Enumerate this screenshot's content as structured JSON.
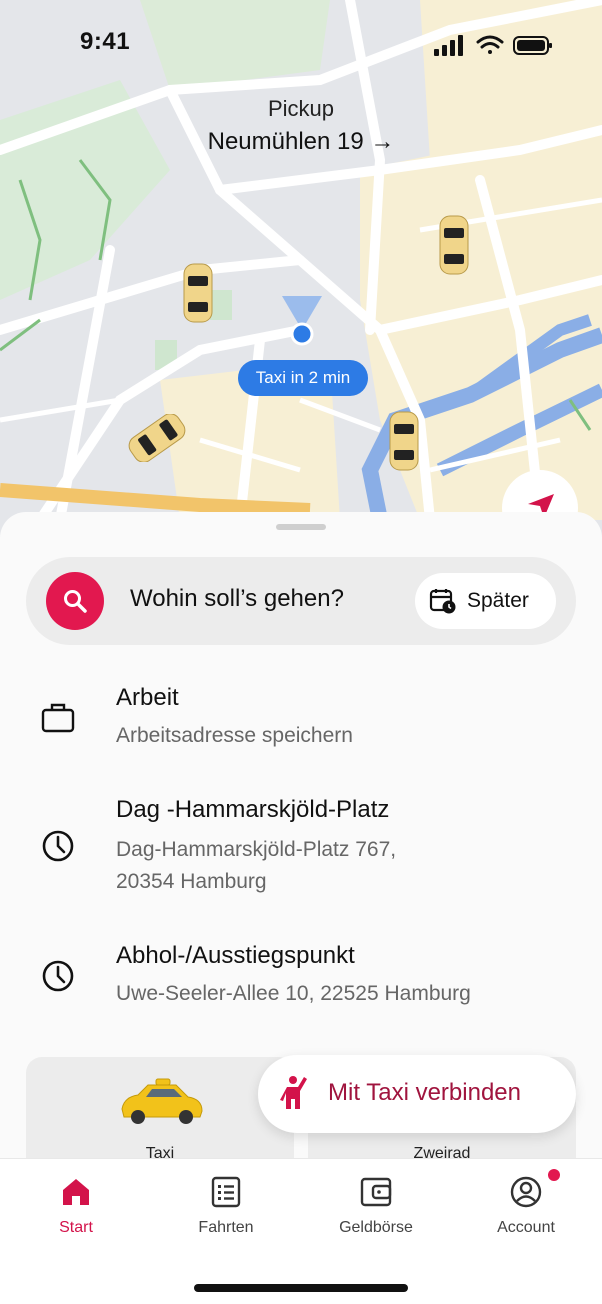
{
  "status": {
    "time": "9:41"
  },
  "map": {
    "pickup_label": "Pickup",
    "pickup_address": "Neumühlen 19 →",
    "taxi_eta": "Taxi in 2 min"
  },
  "search": {
    "placeholder": "Wohin soll’s gehen?",
    "later_label": "Später"
  },
  "places": [
    {
      "title": "Arbeit",
      "subtitle": "Arbeitsadresse speichern",
      "icon": "briefcase-icon"
    },
    {
      "title": "Dag -Hammarskjöld-Platz",
      "subtitle_line1": "Dag-Hammarskjöld-Platz 767,",
      "subtitle_line2": "20354 Hamburg",
      "icon": "clock-icon"
    },
    {
      "title": "Abhol-/Ausstiegspunkt",
      "subtitle": "Uwe-Seeler-Allee 10, 22525 Hamburg",
      "icon": "clock-icon"
    }
  ],
  "services": [
    {
      "label": "Taxi"
    },
    {
      "label": "Zweirad"
    }
  ],
  "connect_button": "Mit Taxi verbinden",
  "nav": [
    {
      "label": "Start",
      "icon": "home-icon",
      "active": true
    },
    {
      "label": "Fahrten",
      "icon": "list-icon"
    },
    {
      "label": "Geldbörse",
      "icon": "wallet-icon"
    },
    {
      "label": "Account",
      "icon": "account-icon",
      "badge": true
    }
  ],
  "colors": {
    "accent": "#e2184f",
    "nav_active": "#d3134a",
    "eta_blue": "#2d7be5",
    "connect_text": "#a0143e"
  }
}
